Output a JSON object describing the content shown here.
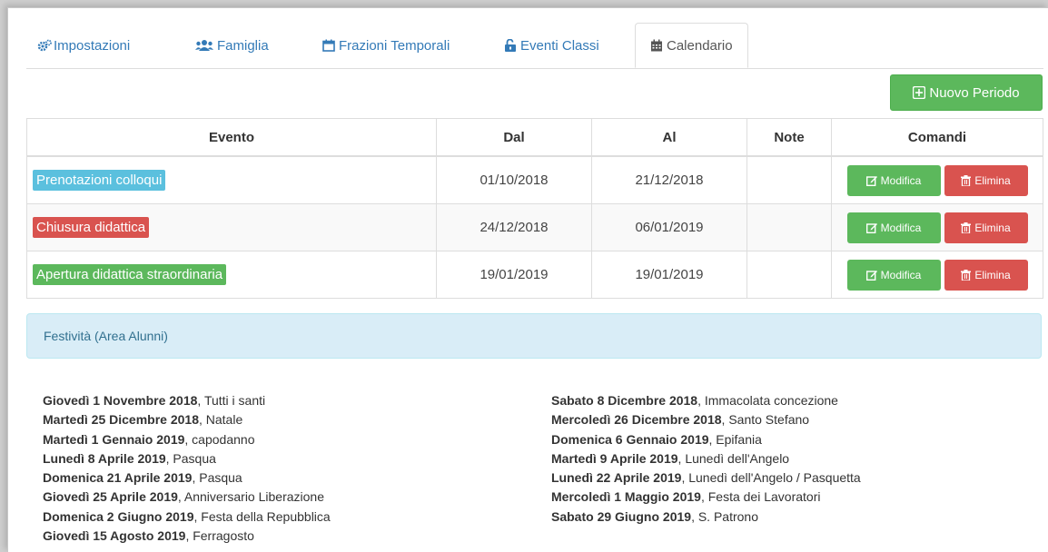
{
  "tabs": [
    {
      "label": "Impostazioni",
      "icon": "cogs-icon"
    },
    {
      "label": "Famiglia",
      "icon": "users-icon"
    },
    {
      "label": "Frazioni Temporali",
      "icon": "calendar-outline-icon"
    },
    {
      "label": "Eventi Classi",
      "icon": "unlock-icon"
    },
    {
      "label": "Calendario",
      "icon": "calendar-icon",
      "active": true
    }
  ],
  "new_period_label": "Nuovo Periodo",
  "table": {
    "headers": [
      "Evento",
      "Dal",
      "Al",
      "Note",
      "Comandi"
    ],
    "rows": [
      {
        "event": "Prenotazioni colloqui",
        "color": "#5bc0de",
        "from": "01/10/2018",
        "to": "21/12/2018",
        "note": ""
      },
      {
        "event": "Chiusura didattica",
        "color": "#d9534f",
        "from": "24/12/2018",
        "to": "06/01/2019",
        "note": ""
      },
      {
        "event": "Apertura didattica straordinaria",
        "color": "#5cb85c",
        "from": "19/01/2019",
        "to": "19/01/2019",
        "note": ""
      }
    ],
    "edit_label": "Modifica",
    "delete_label": "Elimina"
  },
  "holidays_panel_title": "Festività (Area Alunni)",
  "holidays_left": [
    {
      "date": "Giovedì 1 Novembre 2018",
      "name": ", Tutti i santi"
    },
    {
      "date": "Martedì 25 Dicembre 2018",
      "name": ", Natale"
    },
    {
      "date": "Martedì 1 Gennaio 2019",
      "name": ", capodanno"
    },
    {
      "date": "Lunedì 8 Aprile 2019",
      "name": ", Pasqua"
    },
    {
      "date": "Domenica 21 Aprile 2019",
      "name": ", Pasqua"
    },
    {
      "date": "Giovedì 25 Aprile 2019",
      "name": ", Anniversario Liberazione"
    },
    {
      "date": "Domenica 2 Giugno 2019",
      "name": ", Festa della Repubblica"
    },
    {
      "date": "Giovedì 15 Agosto 2019",
      "name": ", Ferragosto"
    }
  ],
  "holidays_right": [
    {
      "date": "Sabato 8 Dicembre 2018",
      "name": ", Immacolata concezione"
    },
    {
      "date": "Mercoledì 26 Dicembre 2018",
      "name": ", Santo Stefano"
    },
    {
      "date": "Domenica 6 Gennaio 2019",
      "name": ", Epifania"
    },
    {
      "date": "Martedì 9 Aprile 2019",
      "name": ", Lunedì dell'Angelo"
    },
    {
      "date": "Lunedì 22 Aprile 2019",
      "name": ", Lunedì dell'Angelo / Pasquetta"
    },
    {
      "date": "Mercoledì 1 Maggio 2019",
      "name": ", Festa dei Lavoratori"
    },
    {
      "date": "Sabato 29 Giugno 2019",
      "name": ", S. Patrono"
    }
  ]
}
